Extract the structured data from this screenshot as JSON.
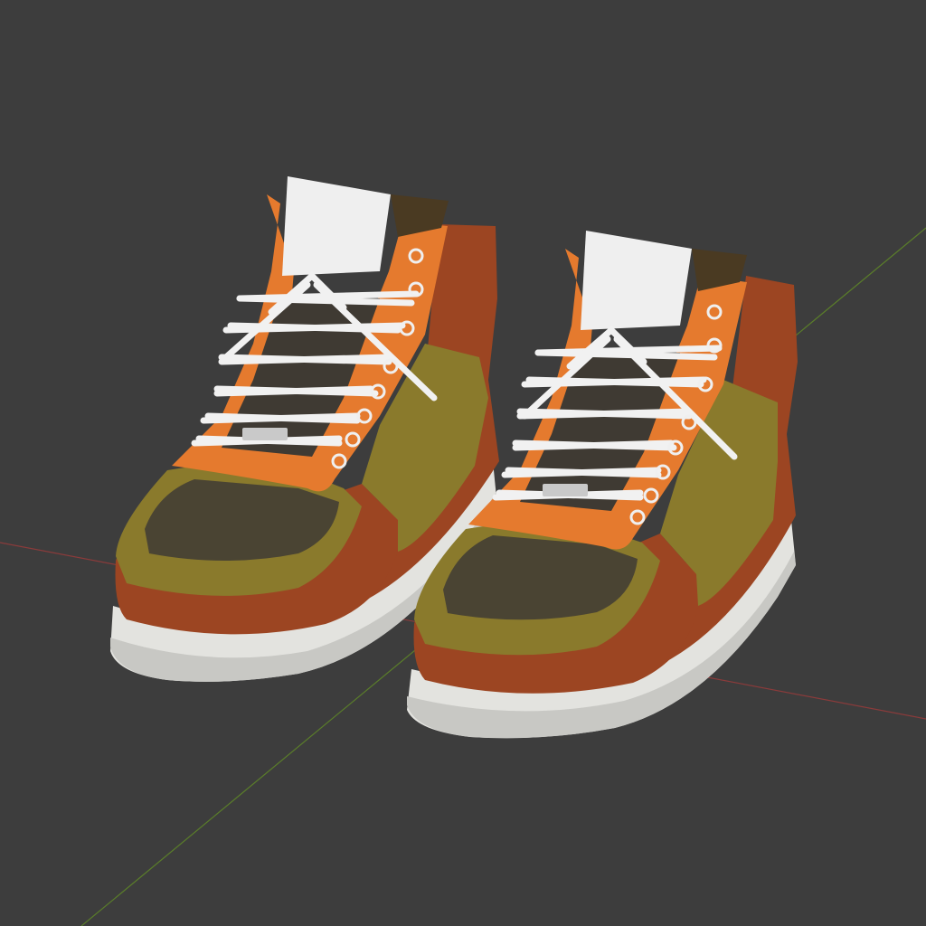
{
  "viewport": {
    "name": "3D Viewport",
    "background": "#3d3d3d"
  },
  "axes": {
    "x_axis_color": "#8a3b3b",
    "y_axis_color": "#5a7d2a"
  },
  "objects": [
    {
      "name": "left-shoe"
    },
    {
      "name": "right-shoe"
    }
  ],
  "palette": {
    "sole": "#e3e3df",
    "sole_shadow": "#b9b9b5",
    "rust": "#9c4522",
    "rust_dark": "#7f3517",
    "olive": "#8a7a2c",
    "olive_dark": "#6f6322",
    "toe_dark": "#4a4433",
    "orange": "#e57a2e",
    "orange_dark": "#c4621f",
    "tongue": "#efefef",
    "collar": "#4a3a22",
    "lace": "#f1f1f1",
    "inner": "#3f3a33",
    "metal": "#c9c9c9"
  }
}
